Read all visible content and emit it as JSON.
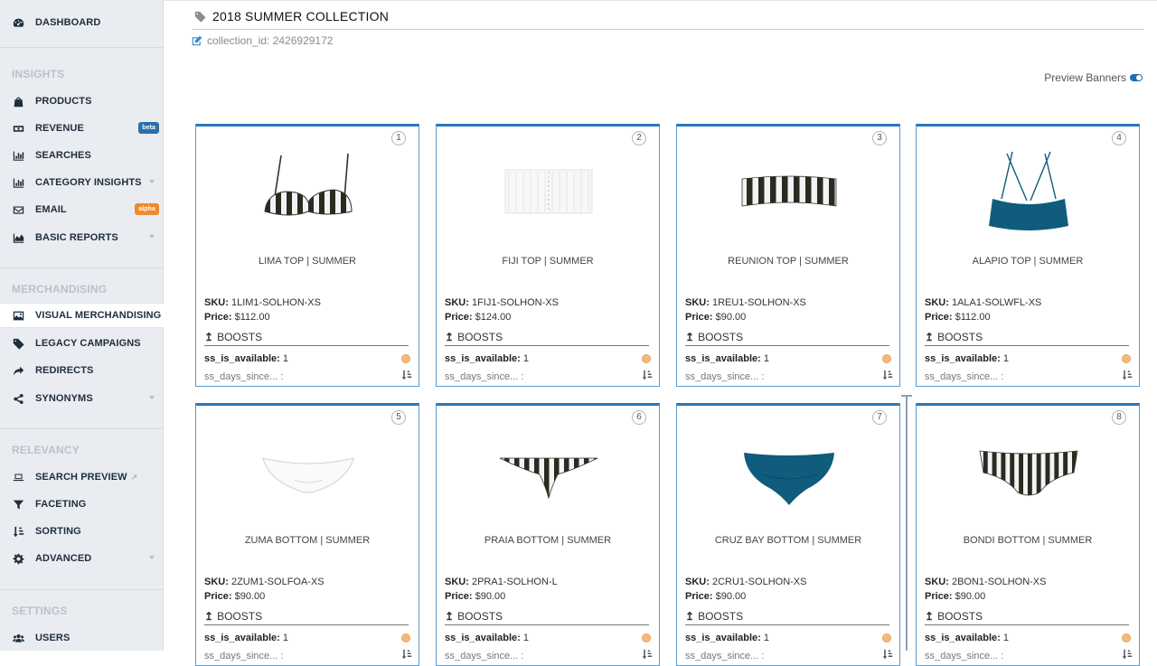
{
  "sidebar": {
    "dashboard": "DASHBOARD",
    "sections": {
      "insights": "INSIGHTS",
      "merchandising": "MERCHANDISING",
      "relevancy": "RELEVANCY",
      "settings": "SETTINGS"
    },
    "items": {
      "products": "PRODUCTS",
      "revenue": "REVENUE",
      "revenue_badge": "beta",
      "searches": "SEARCHES",
      "category_insights": "CATEGORY INSIGHTS",
      "email": "EMAIL",
      "email_badge": "alpha",
      "basic_reports": "BASIC REPORTS",
      "visual_merchandising": "VISUAL MERCHANDISING",
      "legacy_campaigns": "LEGACY CAMPAIGNS",
      "redirects": "REDIRECTS",
      "synonyms": "SYNONYMS",
      "search_preview": "SEARCH PREVIEW",
      "faceting": "FACETING",
      "sorting": "SORTING",
      "advanced": "ADVANCED",
      "users": "USERS"
    }
  },
  "header": {
    "title": "2018 SUMMER COLLECTION",
    "collection_id": "collection_id: 2426929172",
    "preview_banners": "Preview Banners"
  },
  "card_labels": {
    "sku": "SKU:",
    "price": "Price:",
    "boosts": "BOOSTS",
    "attr1": "ss_is_available:",
    "attr2": "ss_days_since...",
    "attr2_sep": ":"
  },
  "products": [
    {
      "num": "1",
      "name": "LIMA TOP | SUMMER",
      "sku": "1LIM1-SOLHON-XS",
      "price": "$112.00",
      "available": "1"
    },
    {
      "num": "2",
      "name": "FIJI TOP | SUMMER",
      "sku": "1FIJ1-SOLHON-XS",
      "price": "$124.00",
      "available": "1"
    },
    {
      "num": "3",
      "name": "REUNION TOP | SUMMER",
      "sku": "1REU1-SOLHON-XS",
      "price": "$90.00",
      "available": "1"
    },
    {
      "num": "4",
      "name": "ALAPIO TOP | SUMMER",
      "sku": "1ALA1-SOLWFL-XS",
      "price": "$112.00",
      "available": "1"
    },
    {
      "num": "5",
      "name": "ZUMA BOTTOM | SUMMER",
      "sku": "2ZUM1-SOLFOA-XS",
      "price": "$90.00",
      "available": "1"
    },
    {
      "num": "6",
      "name": "PRAIA BOTTOM | SUMMER",
      "sku": "2PRA1-SOLHON-L",
      "price": "$90.00",
      "available": "1"
    },
    {
      "num": "7",
      "name": "CRUZ BAY BOTTOM | SUMMER",
      "sku": "2CRU1-SOLHON-XS",
      "price": "$90.00",
      "available": "1"
    },
    {
      "num": "8",
      "name": "BONDI BOTTOM | SUMMER",
      "sku": "2BON1-SOLHON-XS",
      "price": "$90.00",
      "available": "1"
    }
  ],
  "colors": {
    "accent": "#2a78be",
    "sidebar_bg": "#e9edf1",
    "teal": "#0f5c7d",
    "dot": "#f5b97a"
  }
}
